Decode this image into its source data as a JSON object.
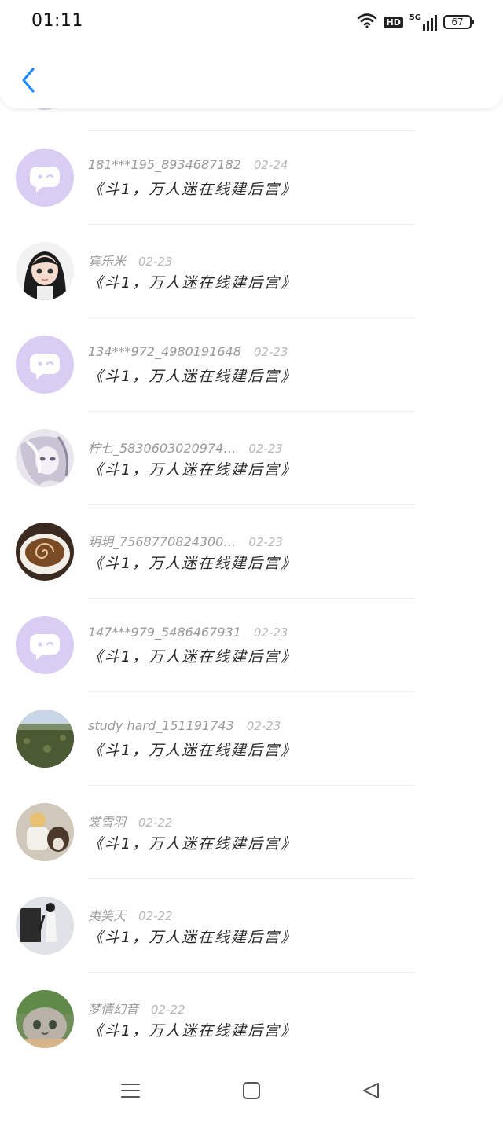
{
  "status_bar": {
    "time": "01:11",
    "network": "5G",
    "hd": "HD",
    "battery": "67"
  },
  "comments": [
    {
      "user": "181***195_8934687182",
      "date": "02-24",
      "text": "《斗1，万人迷在线建后宫》",
      "avatar": "chat-bubble"
    },
    {
      "user": "宾乐米",
      "date": "02-23",
      "text": "《斗1，万人迷在线建后宫》",
      "avatar": "girl-cartoon"
    },
    {
      "user": "134***972_4980191648",
      "date": "02-23",
      "text": "《斗1，万人迷在线建后宫》",
      "avatar": "chat-bubble"
    },
    {
      "user": "柠七_5830603020974…",
      "date": "02-23",
      "text": "《斗1，万人迷在线建后宫》",
      "avatar": "anime-girl"
    },
    {
      "user": "玥玥_7568770824300…",
      "date": "02-23",
      "text": "《斗1，万人迷在线建后宫》",
      "avatar": "coffee-cup"
    },
    {
      "user": "147***979_5486467931",
      "date": "02-23",
      "text": "《斗1，万人迷在线建后宫》",
      "avatar": "chat-bubble"
    },
    {
      "user": "study hard_151191743",
      "date": "02-23",
      "text": "《斗1，万人迷在线建后宫》",
      "avatar": "landscape"
    },
    {
      "user": "裳雪羽",
      "date": "02-22",
      "text": "《斗1，万人迷在线建后宫》",
      "avatar": "person-dog"
    },
    {
      "user": "夷笑天",
      "date": "02-22",
      "text": "《斗1，万人迷在线建后宫》",
      "avatar": "person-photo"
    },
    {
      "user": "梦情幻音",
      "date": "02-22",
      "text": "《斗1，万人迷在线建后宫》",
      "avatar": "cat"
    }
  ],
  "colors": {
    "accent": "#1a8cff",
    "bubble_bg": "#d9cdf4",
    "name": "#9a9a9a",
    "date": "#b7b7b7"
  }
}
